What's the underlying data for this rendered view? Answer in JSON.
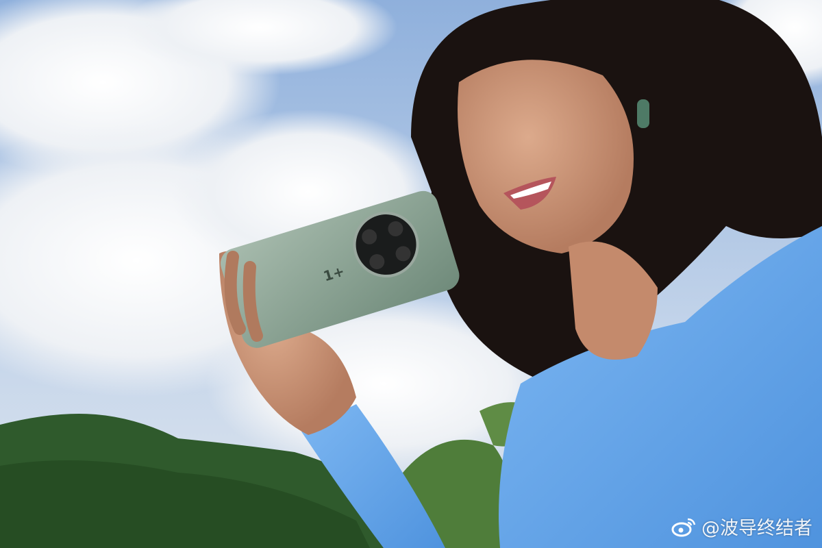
{
  "watermark": {
    "handle": "@波导终结者",
    "icon": "weibo-logo-icon"
  },
  "phone": {
    "logo": "1+"
  },
  "colors": {
    "sky": "#9fbbe0",
    "cloud": "#f2f4f6",
    "sweater": "#5fa3ea",
    "phone": "#8ea797",
    "hair": "#1a1210",
    "skin": "#c99073",
    "trees": "#2f5a2c"
  }
}
